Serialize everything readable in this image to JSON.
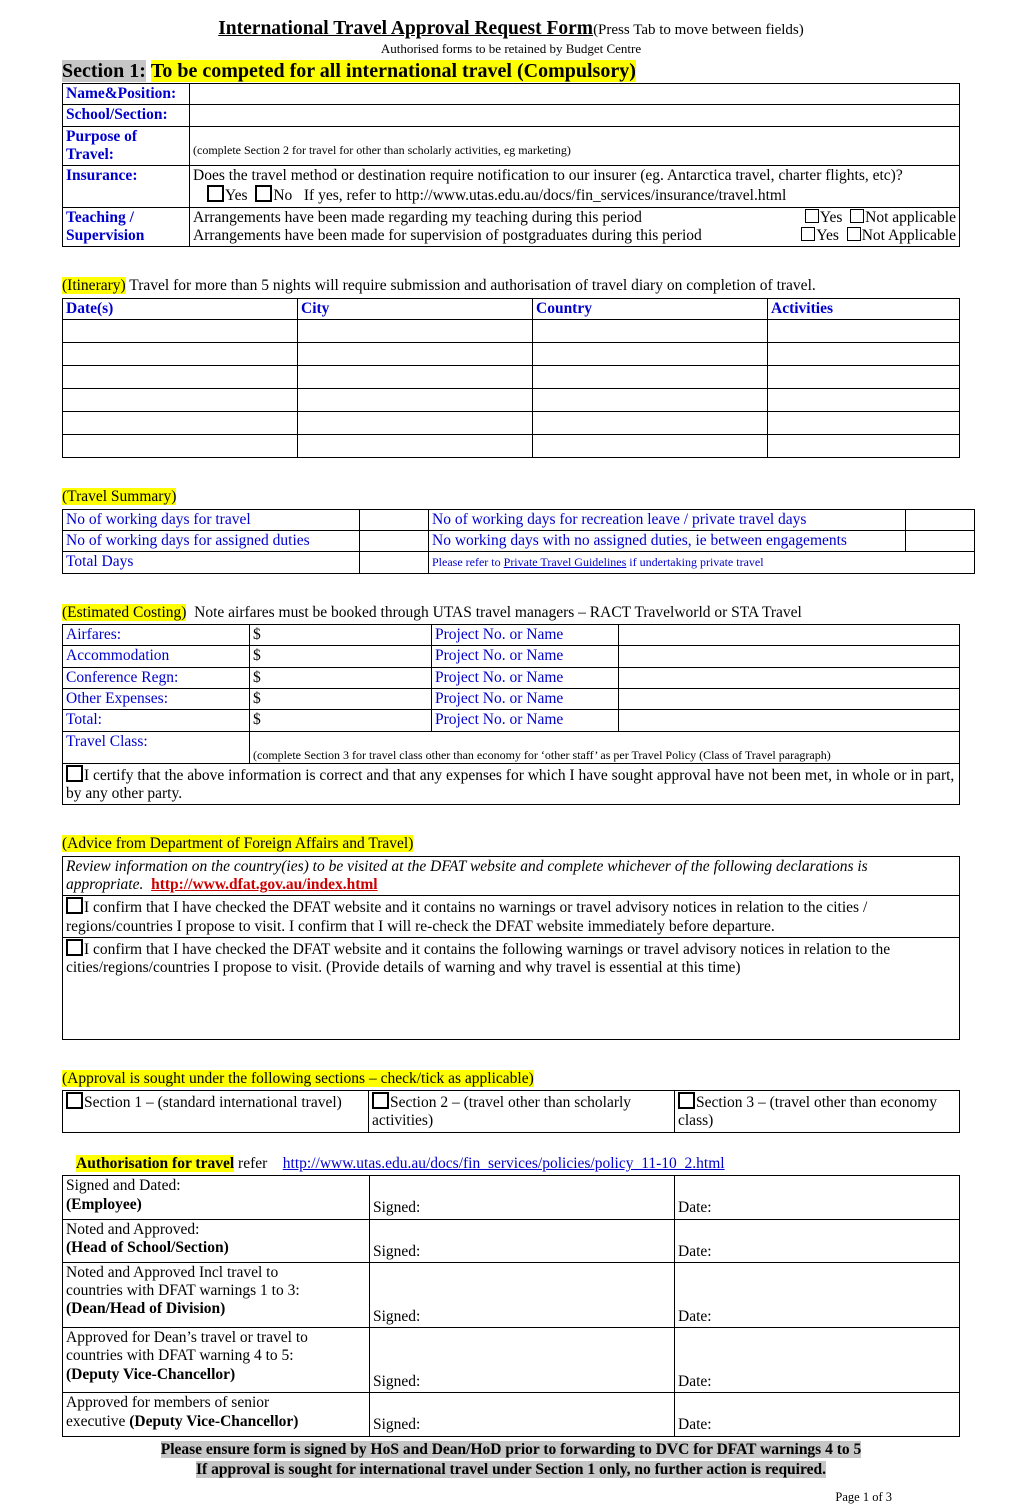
{
  "document": {
    "title_main": "International Travel Approval Request Form",
    "title_suffix": "(Press Tab to move between fields)",
    "subtitle": "Authorised forms to be retained by Budget Centre",
    "page_number": "Page 1 of 3"
  },
  "section1": {
    "label": "Section 1:",
    "heading": "To be competed for all international travel (Compulsory)",
    "rows": {
      "name_position_label": "Name&Position:",
      "name_position_value": "",
      "school_section_label": "School/Section:",
      "school_section_value": "",
      "purpose_label_line1": "Purpose of",
      "purpose_label_line2": "Travel:",
      "purpose_note": "(complete Section 2 for travel for other than scholarly activities, eg marketing)",
      "insurance_label": "Insurance:",
      "insurance_question": "Does the travel method or destination require notification to our insurer (eg. Antarctica travel, charter flights, etc)?",
      "insurance_yes": "Yes",
      "insurance_no": "No",
      "insurance_refer": "If yes, refer to http://www.utas.edu.au/docs/fin_services/insurance/travel.html",
      "teaching_label_line1": "Teaching /",
      "teaching_label_line2": "Supervision",
      "teaching_statement": "Arrangements have been made regarding my teaching during this period",
      "teaching_yes": "Yes",
      "teaching_na": "Not applicable",
      "supervision_statement": "Arrangements have been made for supervision of postgraduates during this period",
      "supervision_yes": "Yes",
      "supervision_na": "Not Applicable"
    }
  },
  "itinerary": {
    "tag": "(Itinerary)",
    "lead": "Travel for more than 5 nights will require submission and authorisation of travel diary on completion of travel.",
    "columns": [
      "Date(s)",
      "City",
      "Country",
      "Activities"
    ],
    "rows": [
      [
        "",
        "",
        "",
        ""
      ],
      [
        "",
        "",
        "",
        ""
      ],
      [
        "",
        "",
        "",
        ""
      ],
      [
        "",
        "",
        "",
        ""
      ],
      [
        "",
        "",
        "",
        ""
      ],
      [
        "",
        "",
        "",
        ""
      ]
    ]
  },
  "travel_summary": {
    "tag": "(Travel Summary)",
    "rows": [
      {
        "left_label": "No of working days for travel",
        "left_value": "",
        "right_label": "No of working days for recreation leave / private travel days",
        "right_value": ""
      },
      {
        "left_label": "No of working days for assigned duties",
        "left_value": "",
        "right_label": "No working days with no assigned duties, ie between engagements",
        "right_value": ""
      }
    ],
    "total_label": "Total Days",
    "total_value": "",
    "note_prefix": "Please refer to ",
    "note_link": "Private Travel Guidelines",
    "note_suffix": " if undertaking private travel"
  },
  "estimated_costing": {
    "tag": "(Estimated Costing)",
    "lead": "Note airfares must be booked through UTAS travel managers – RACT Travelworld or STA Travel",
    "project_header": "Project No. or Name",
    "currency_symbol": "$",
    "rows": [
      {
        "label": "Airfares:",
        "amount": "$",
        "project_label": "Project No. or Name",
        "project_value": ""
      },
      {
        "label": "Accommodation",
        "amount": "$",
        "project_label": "Project No. or Name",
        "project_value": ""
      },
      {
        "label": "Conference Regn:",
        "amount": "$",
        "project_label": "Project No. or Name",
        "project_value": ""
      },
      {
        "label": "Other Expenses:",
        "amount": "$",
        "project_label": "Project No. or Name",
        "project_value": ""
      },
      {
        "label": "Total:",
        "amount": "$",
        "project_label": "Project No. or Name",
        "project_value": ""
      }
    ],
    "travel_class_label": "Travel Class:",
    "travel_class_value": "",
    "travel_class_note": "(complete Section 3 for travel class other than economy for ‘other staff’ as per Travel Policy (Class of Travel paragraph)",
    "certify_text": "I certify that the above information is correct and that any expenses for which I have sought approval have not been met, in whole or in part, by any other party."
  },
  "dfat": {
    "tag": "(Advice from Department of Foreign Affairs and Travel)",
    "review_text": "Review information on the country(ies) to be visited at the DFAT website and complete whichever of the following declarations is appropriate.",
    "review_link": "http://www.dfat.gov.au/index.html",
    "declaration_1": "I confirm that I have checked the DFAT website and it contains no warnings or travel advisory notices in relation to the cities / regions/countries I propose to visit.  I confirm that I will re-check the DFAT website immediately before departure.",
    "declaration_2": "I confirm that I have checked the DFAT website and it contains the following warnings or travel advisory notices in relation to the cities/regions/countries I propose to visit.  (Provide details of warning and why travel is essential at this time)",
    "declaration_2_detail": ""
  },
  "approval_sections": {
    "tag": "(Approval is sought under the following sections – check/tick as applicable)",
    "options": [
      "Section 1 – (standard international travel)",
      "Section 2 – (travel other than scholarly activities)",
      "Section 3 – (travel other than economy class)"
    ]
  },
  "authorisation": {
    "tag": "Authorisation for travel",
    "refer_word": "refer",
    "link": "http://www.utas.edu.au/docs/fin_services/policies/policy_11-10_2.html",
    "signed_label": "Signed:",
    "date_label": "Date:",
    "rows": [
      {
        "lines": [
          "Signed and Dated:"
        ],
        "bold_line": "(Employee)",
        "signed": "Signed:",
        "date": "Date:"
      },
      {
        "lines": [
          "Noted and Approved:"
        ],
        "bold_line": "(Head of School/Section)",
        "signed": "Signed:",
        "date": "Date:"
      },
      {
        "lines": [
          "Noted and Approved Incl travel to",
          "countries with DFAT warnings 1 to 3:"
        ],
        "bold_line": "(Dean/Head of Division)",
        "signed": "Signed:",
        "date": "Date:"
      },
      {
        "lines": [
          "Approved for Dean’s travel or travel to",
          "countries with DFAT warning 4 to 5:"
        ],
        "bold_line": "(Deputy Vice-Chancellor)",
        "signed": "Signed:",
        "date": "Date:"
      },
      {
        "lines": [
          "Approved for members of senior"
        ],
        "inline_prefix": "executive ",
        "bold_line": "(Deputy Vice-Chancellor)",
        "signed": "Signed:",
        "date": "Date:"
      }
    ]
  },
  "footer": {
    "line1": "Please ensure form is signed by HoS and Dean/HoD prior to forwarding to DVC for DFAT warnings 4 to 5",
    "line2": "If approval is sought for international travel under Section 1 only, no further action is required."
  },
  "colors": {
    "highlight_yellow": "#ffff00",
    "highlight_gray": "#c6c6c6",
    "label_blue": "#0000cc",
    "link_red": "#cc0000"
  }
}
